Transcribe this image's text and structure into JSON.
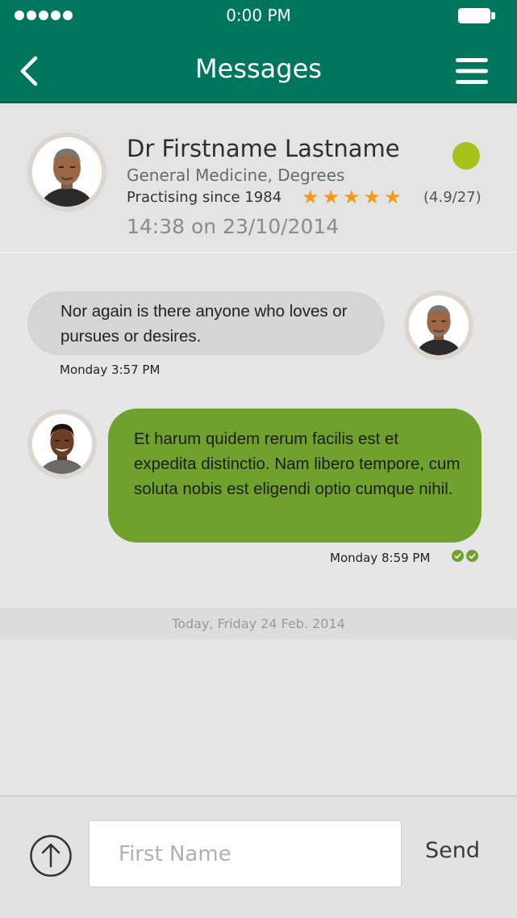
{
  "status_bar": {
    "time": "0:00 PM"
  },
  "header": {
    "title": "Messages"
  },
  "doctor": {
    "name": "Dr Firstname Lastname",
    "specialty": "General Medicine, Degrees",
    "practising": "Practising since 1984",
    "rating_text": "(4.9/27)",
    "stars": 5,
    "timestamp": "14:38 on 23/10/2014",
    "online_color": "#a6c31a"
  },
  "messages": [
    {
      "direction": "incoming",
      "text": "Nor again is there anyone who loves or pursues or desires.",
      "time": "Monday 3:57 PM"
    },
    {
      "direction": "outgoing",
      "text": "Et harum quidem rerum facilis est et expedita distinctio. Nam libero tempore, cum soluta nobis est eligendi optio cumque nihil.",
      "time": "Monday 8:59 PM",
      "read": true
    }
  ],
  "day_separator": "Today, Friday 24 Feb. 2014",
  "composer": {
    "placeholder": "First Name",
    "send_label": "Send"
  },
  "colors": {
    "header": "#00775c",
    "outgoing_bubble": "#6fa12c",
    "incoming_bubble": "#d6d5d5",
    "star": "#f39c12"
  }
}
